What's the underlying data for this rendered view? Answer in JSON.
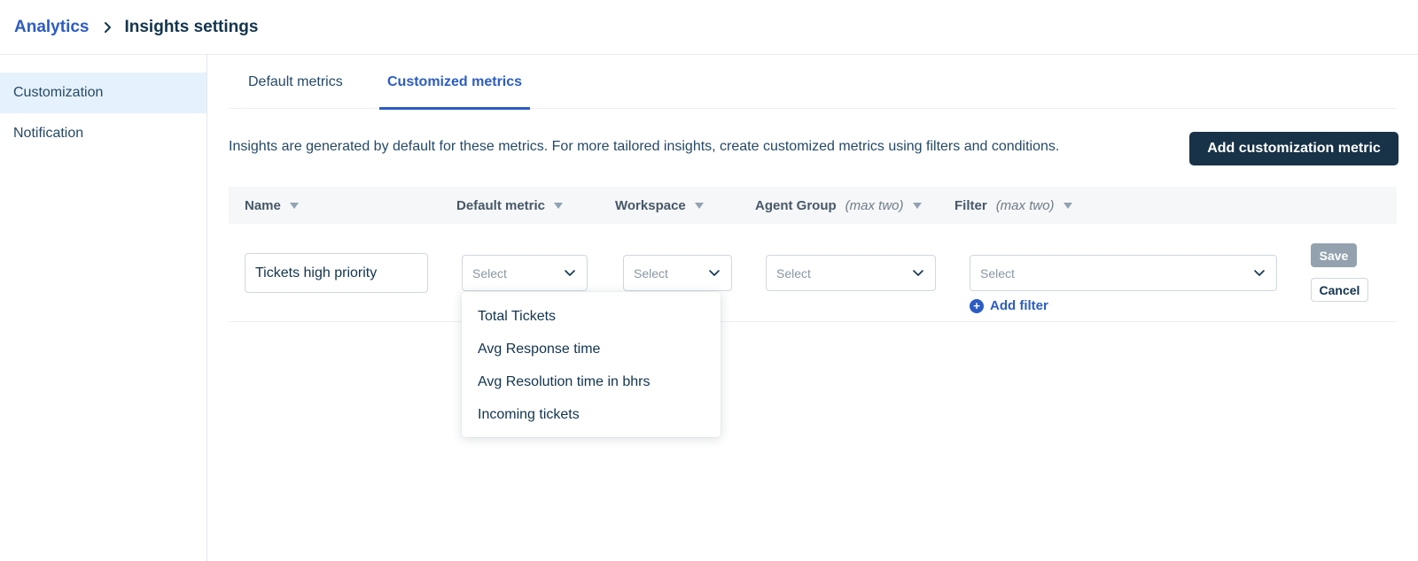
{
  "breadcrumb": {
    "parent": "Analytics",
    "current": "Insights settings"
  },
  "sidebar": {
    "items": [
      {
        "label": "Customization",
        "active": true
      },
      {
        "label": "Notification",
        "active": false
      }
    ]
  },
  "tabs": [
    {
      "label": "Default metrics",
      "active": false
    },
    {
      "label": "Customized metrics",
      "active": true
    }
  ],
  "description": "Insights are generated by default for these metrics. For more tailored insights, create customized metrics using filters and conditions.",
  "add_button": "Add customization metric",
  "table": {
    "headers": {
      "name": "Name",
      "default_metric": "Default metric",
      "workspace": "Workspace",
      "agent_group": "Agent Group",
      "agent_group_hint": "(max two)",
      "filter": "Filter",
      "filter_hint": "(max two)"
    },
    "row": {
      "name_value": "Tickets high priority",
      "default_metric_placeholder": "Select",
      "workspace_placeholder": "Select",
      "agent_group_placeholder": "Select",
      "filter_placeholder": "Select",
      "add_filter": "Add filter",
      "save": "Save",
      "cancel": "Cancel"
    }
  },
  "dropdown": {
    "options": [
      "Total Tickets",
      "Avg Response time",
      "Avg Resolution time in bhrs",
      "Incoming tickets"
    ]
  },
  "colors": {
    "accent": "#2c5cc5",
    "primary_button": "#183247",
    "active_sidebar": "#e5f2fd",
    "disabled_button": "#93a2ae"
  }
}
